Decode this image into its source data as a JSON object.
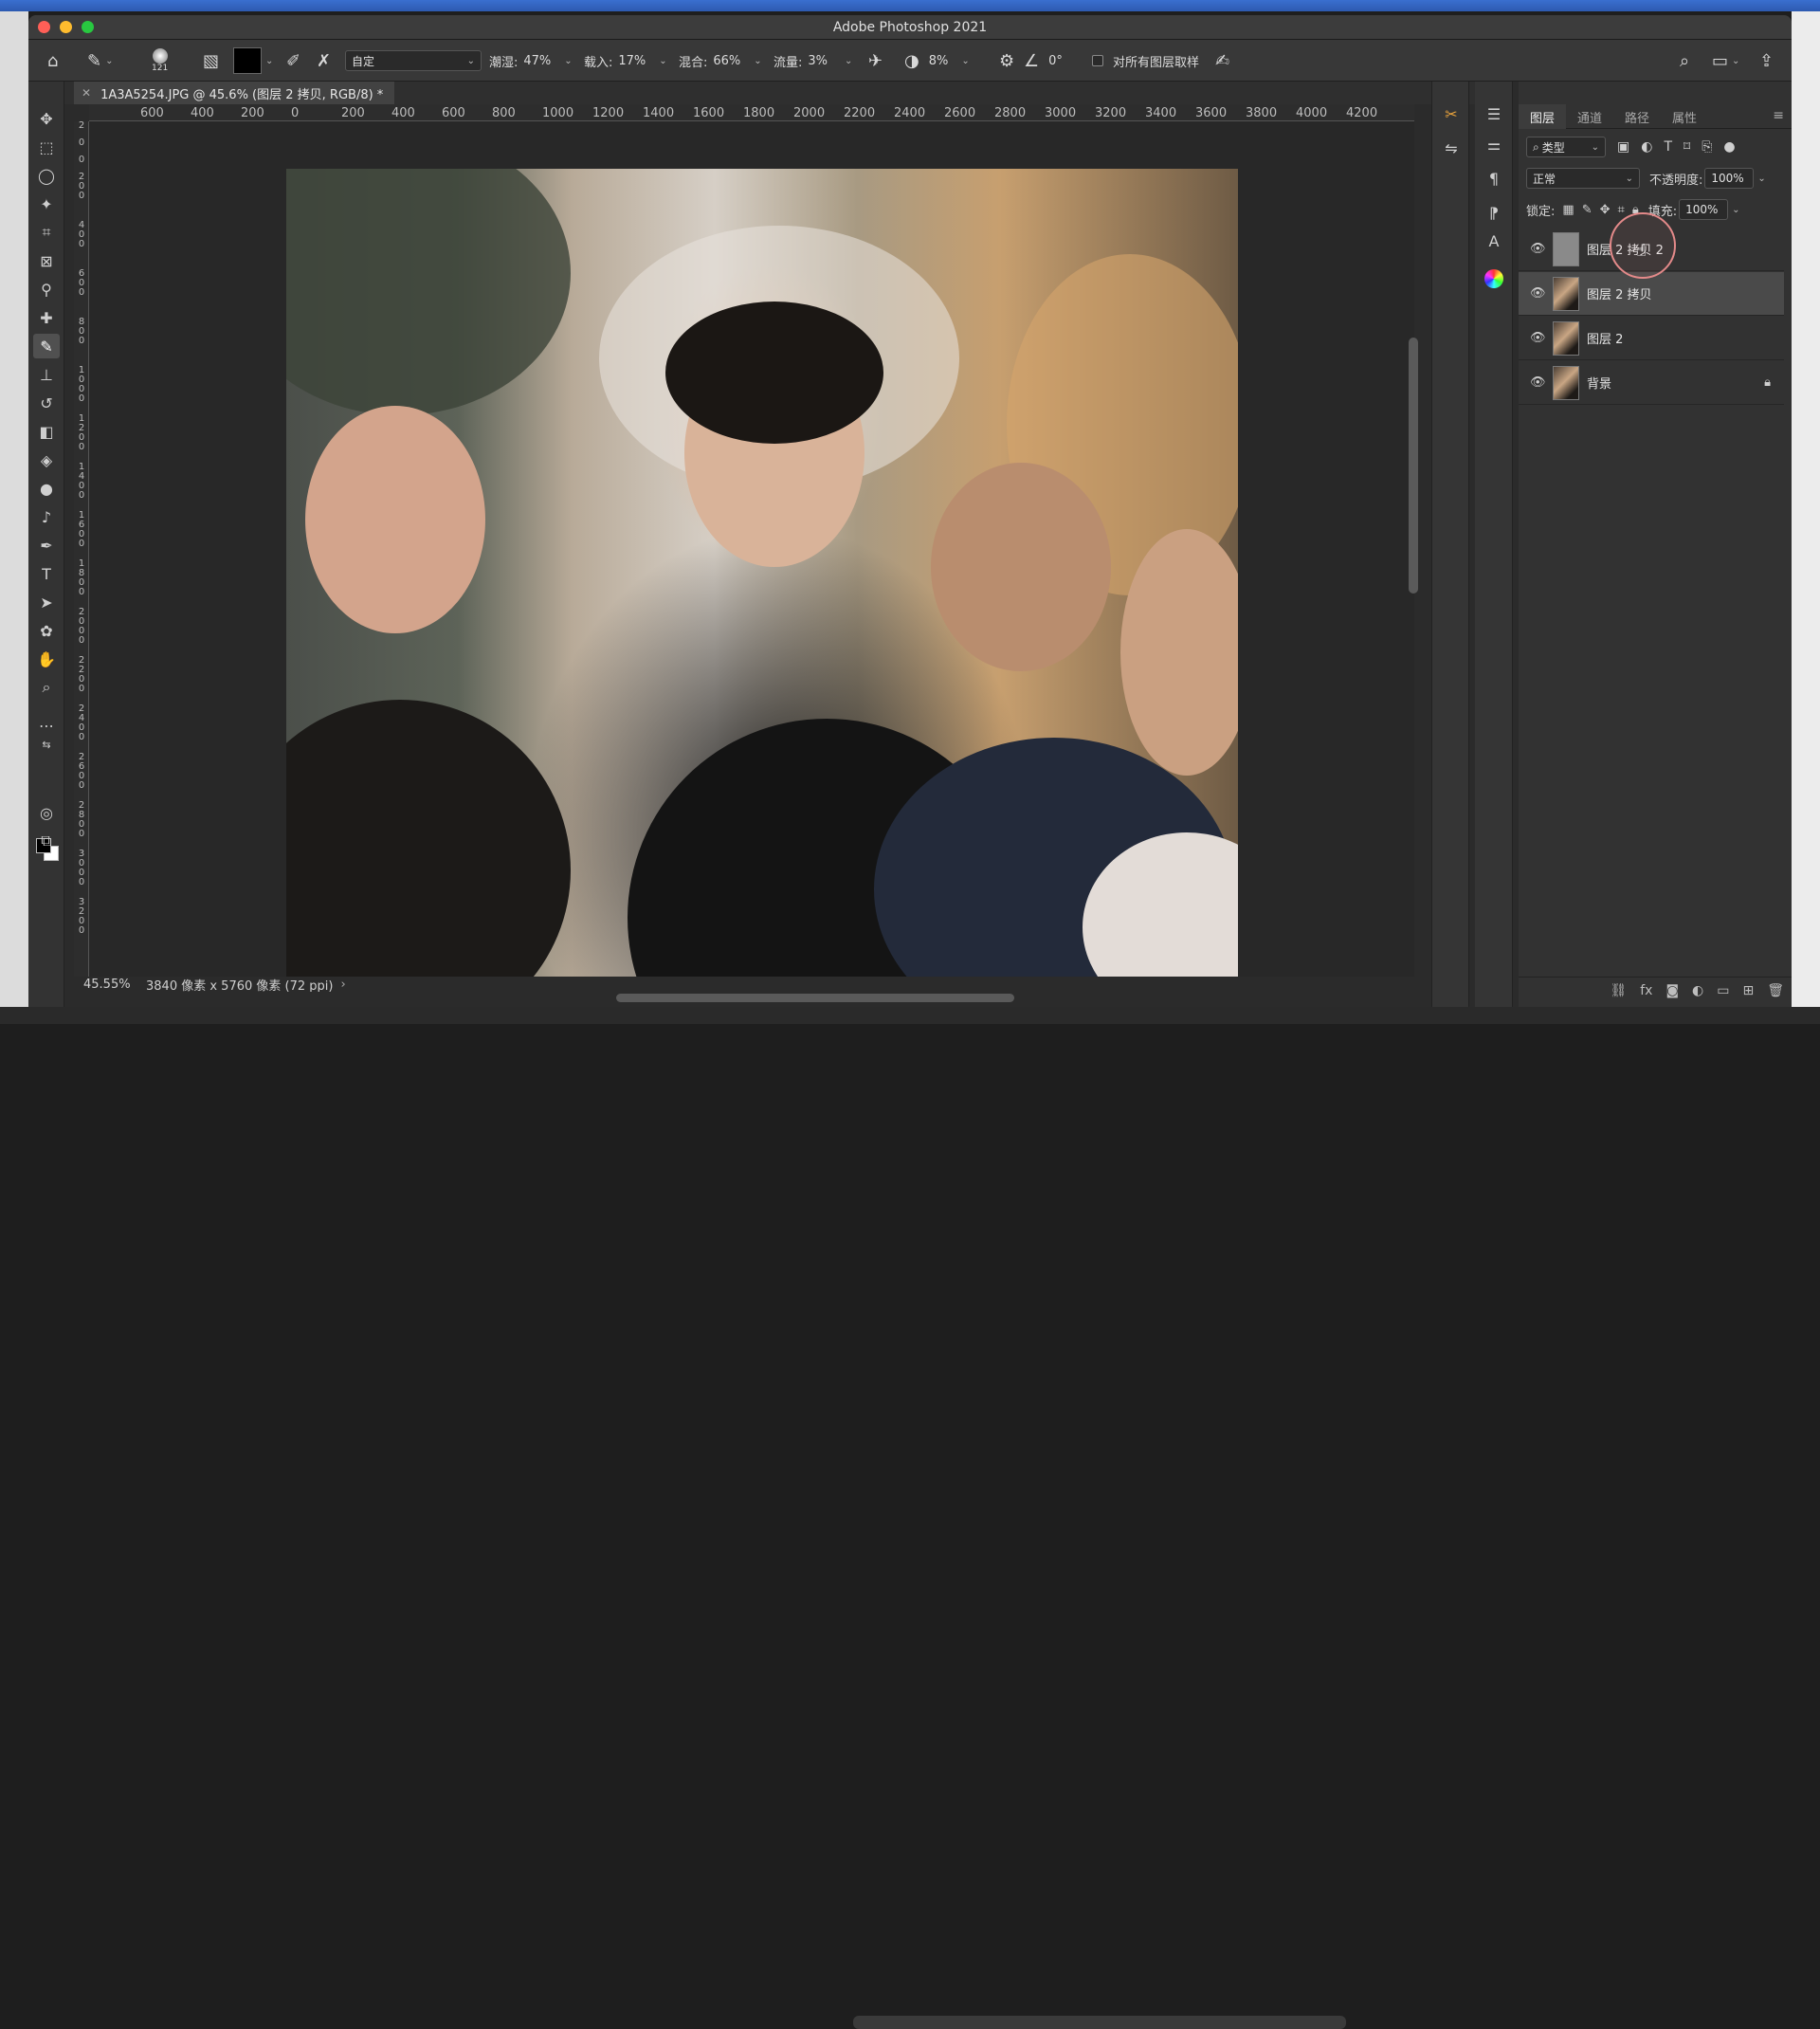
{
  "app": {
    "title": "Adobe Photoshop 2021",
    "document_tab": "1A3A5254.JPG @ 45.6% (图层 2 拷贝, RGB/8) *"
  },
  "options_bar": {
    "brush_size": "121",
    "mode_label": "自定",
    "wet_label": "潮湿:",
    "wet_value": "47%",
    "load_label": "载入:",
    "load_value": "17%",
    "mix_label": "混合:",
    "mix_value": "66%",
    "flow_label": "流量:",
    "flow_value": "3%",
    "smoothing_value": "8%",
    "angle_value": "0°",
    "sample_all_label": "对所有图层取样"
  },
  "ruler_top_labels": [
    "600",
    "400",
    "200",
    "0",
    "200",
    "400",
    "600",
    "800",
    "1000",
    "1200",
    "1400",
    "1600",
    "1800",
    "2000",
    "2200",
    "2400",
    "2600",
    "2800",
    "3000",
    "3200",
    "3400",
    "3600",
    "3800",
    "4000",
    "4200"
  ],
  "ruler_left_labels": [
    "2",
    "0",
    "0",
    "2 0 0",
    "4 0 0",
    "6 0 0",
    "8 0 0",
    "1 0 0 0",
    "1 2 0 0",
    "1 4 0 0",
    "1 6 0 0",
    "1 8 0 0",
    "2 0 0 0",
    "2 2 0 0",
    "2 4 0 0",
    "2 6 0 0",
    "2 8 0 0",
    "3 0 0 0",
    "3 2 0 0"
  ],
  "status": {
    "zoom": "45.55%",
    "doc_info": "3840 像素 x 5760 像素 (72 ppi)",
    "arrow": "›"
  },
  "layers_panel": {
    "tabs": [
      "图层",
      "通道",
      "路径",
      "属性"
    ],
    "filter_label": "类型",
    "blend_mode": "正常",
    "opacity_label": "不透明度:",
    "opacity_value": "100%",
    "lock_label": "锁定:",
    "fill_label": "填充:",
    "fill_value": "100%",
    "layers": [
      {
        "name": "图层 2 拷贝 2",
        "visible": true,
        "selected": false,
        "locked": false
      },
      {
        "name": "图层 2 拷贝",
        "visible": true,
        "selected": true,
        "locked": false
      },
      {
        "name": "图层 2",
        "visible": true,
        "selected": false,
        "locked": false
      },
      {
        "name": "背景",
        "visible": true,
        "selected": false,
        "locked": true
      }
    ]
  },
  "colors": {
    "foreground": "#000000",
    "background": "#ffffff",
    "cursor_ring": "#e48a8a"
  }
}
